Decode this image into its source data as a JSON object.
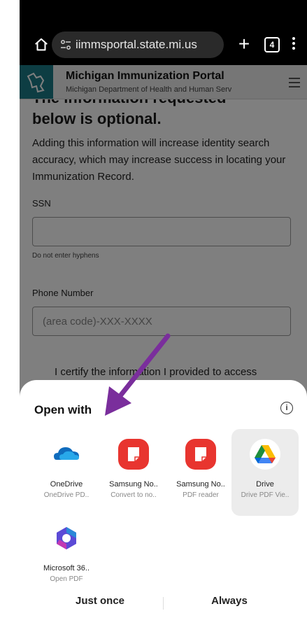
{
  "browser": {
    "url": "iimmsportal.state.mi.us",
    "tab_count": "4"
  },
  "site": {
    "title": "Michigan Immunization Portal",
    "subtitle": "Michigan Department of Health and Human Serv"
  },
  "form": {
    "clipped_heading": "The information requested",
    "heading": "below is optional.",
    "paragraph": "Adding this information will increase identity search accuracy, which may increase success in locating your Immunization Record.",
    "ssn_label": "SSN",
    "ssn_value": "",
    "ssn_hint": "Do not enter hyphens",
    "phone_label": "Phone Number",
    "phone_placeholder": "(area code)-XXX-XXXX",
    "certify_text": "I certify the information I provided to access"
  },
  "sheet": {
    "title": "Open with",
    "apps": [
      {
        "name": "OneDrive",
        "sub": "OneDrive PD.."
      },
      {
        "name": "Samsung No..",
        "sub": "Convert to no.."
      },
      {
        "name": "Samsung No..",
        "sub": "PDF reader"
      },
      {
        "name": "Drive",
        "sub": "Drive PDF Vie.."
      },
      {
        "name": "Microsoft 36..",
        "sub": "Open PDF"
      }
    ],
    "just_once": "Just once",
    "always": "Always"
  },
  "colors": {
    "arrow": "#7a2e9c",
    "samsung_notes": "#e8352f",
    "onedrive": "#0f6cbd",
    "portal_logo": "#1b7a86"
  }
}
